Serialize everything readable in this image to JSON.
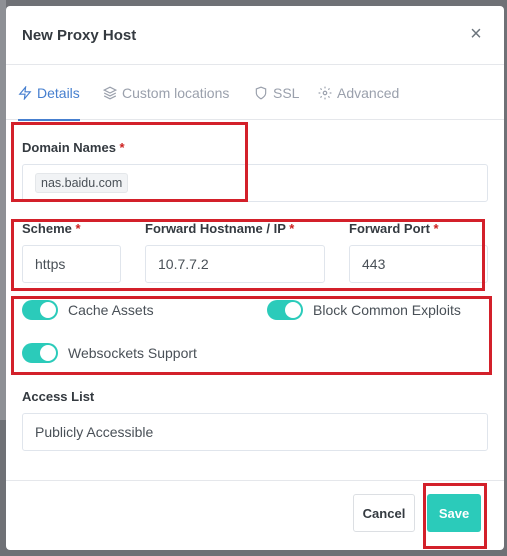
{
  "modal": {
    "title": "New Proxy Host",
    "close_glyph": "×"
  },
  "tabs": [
    {
      "label": "Details",
      "icon": "lightning-icon",
      "active": true
    },
    {
      "label": "Custom locations",
      "icon": "layers-icon",
      "active": false
    },
    {
      "label": "SSL",
      "icon": "shield-icon",
      "active": false
    },
    {
      "label": "Advanced",
      "icon": "gear-icon",
      "active": false
    }
  ],
  "form": {
    "domain_names_label": "Domain Names",
    "required_mark": "*",
    "domain_tag": "nas.baidu.com",
    "scheme_label": "Scheme",
    "scheme_value": "https",
    "forward_host_label": "Forward Hostname / IP",
    "forward_host_value": "10.7.7.2",
    "forward_port_label": "Forward Port",
    "forward_port_value": "443",
    "cache_assets_label": "Cache Assets",
    "block_exploits_label": "Block Common Exploits",
    "websockets_label": "Websockets Support",
    "access_list_label": "Access List",
    "access_list_value": "Publicly Accessible"
  },
  "toggles": {
    "cache_assets": true,
    "block_exploits": true,
    "websockets": true
  },
  "footer": {
    "cancel_label": "Cancel",
    "save_label": "Save"
  },
  "colors": {
    "accent": "#467fcf",
    "toggle_on": "#2bcbba",
    "save": "#2bcbba",
    "required": "#cd201f",
    "highlight_box": "#d3202a"
  }
}
